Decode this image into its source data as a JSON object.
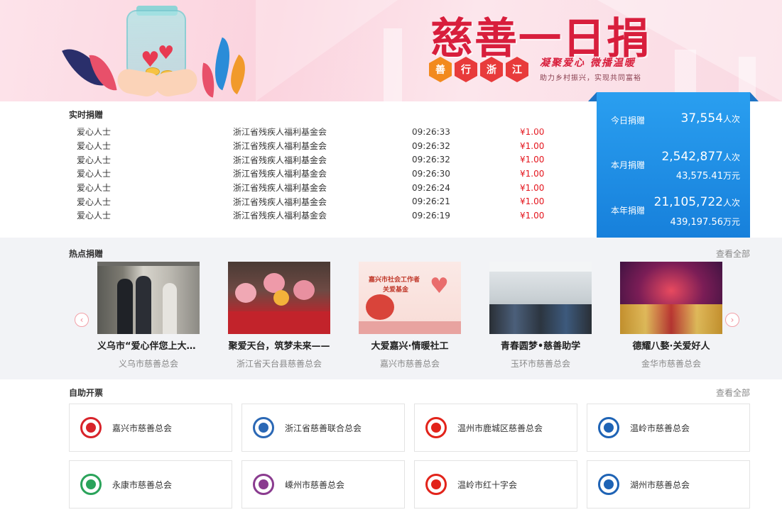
{
  "banner": {
    "title": "慈善一日捐",
    "hex_chars": [
      "善",
      "行",
      "浙",
      "江"
    ],
    "hex_colors": [
      "#f28a1e",
      "#e83b3b",
      "#e83b3b",
      "#e83b3b"
    ],
    "slogan": "凝聚爱心 微播温暖",
    "subslogan": "助力乡村振兴，实现共同富裕"
  },
  "realtime": {
    "title": "实时捐赠",
    "rows": [
      {
        "donor": "爱心人士",
        "org": "浙江省残疾人福利基金会",
        "time": "09:26:33",
        "amount": "¥1.00"
      },
      {
        "donor": "爱心人士",
        "org": "浙江省残疾人福利基金会",
        "time": "09:26:32",
        "amount": "¥1.00"
      },
      {
        "donor": "爱心人士",
        "org": "浙江省残疾人福利基金会",
        "time": "09:26:32",
        "amount": "¥1.00"
      },
      {
        "donor": "爱心人士",
        "org": "浙江省残疾人福利基金会",
        "time": "09:26:30",
        "amount": "¥1.00"
      },
      {
        "donor": "爱心人士",
        "org": "浙江省残疾人福利基金会",
        "time": "09:26:24",
        "amount": "¥1.00"
      },
      {
        "donor": "爱心人士",
        "org": "浙江省残疾人福利基金会",
        "time": "09:26:21",
        "amount": "¥1.00"
      },
      {
        "donor": "爱心人士",
        "org": "浙江省残疾人福利基金会",
        "time": "09:26:19",
        "amount": "¥1.00"
      }
    ]
  },
  "stats": {
    "today_label": "今日捐赠",
    "today_count": "37,554",
    "month_label": "本月捐赠",
    "month_count": "2,542,877",
    "month_amount": "43,575.41",
    "year_label": "本年捐赠",
    "year_count": "21,105,722",
    "year_amount": "439,197.56",
    "unit_times": "人次",
    "unit_money": "万元"
  },
  "hot": {
    "title": "热点捐赠",
    "more": "查看全部",
    "prev_icon": "‹",
    "next_icon": "›",
    "cards": [
      {
        "title": "义乌市“爱心伴您上大学”",
        "org": "义乌市慈善总会"
      },
      {
        "title": "聚爱天台，筑梦未来——",
        "org": "浙江省天台县慈善总会"
      },
      {
        "title": "大爱嘉兴·情暖社工",
        "org": "嘉兴市慈善总会",
        "image_text_1": "嘉兴市社会工作者",
        "image_text_2": "关爱基金"
      },
      {
        "title": "青春圆梦•慈善助学",
        "org": "玉环市慈善总会"
      },
      {
        "title": "德耀八婺·关爱好人",
        "org": "金华市慈善总会"
      }
    ]
  },
  "invoice": {
    "title": "自助开票",
    "more": "查看全部",
    "items": [
      {
        "name": "嘉兴市慈善总会",
        "color": "#d8232a"
      },
      {
        "name": "浙江省慈善联合总会",
        "color": "#2b68b5"
      },
      {
        "name": "温州市鹿城区慈善总会",
        "color": "#e2231a"
      },
      {
        "name": "温岭市慈善总会",
        "color": "#1e63b5"
      },
      {
        "name": "永康市慈善总会",
        "color": "#2aa35a"
      },
      {
        "name": "嵊州市慈善总会",
        "color": "#8a3b8f"
      },
      {
        "name": "温岭市红十字会",
        "color": "#e2231a"
      },
      {
        "name": "湖州市慈善总会",
        "color": "#1e63b5"
      }
    ]
  }
}
